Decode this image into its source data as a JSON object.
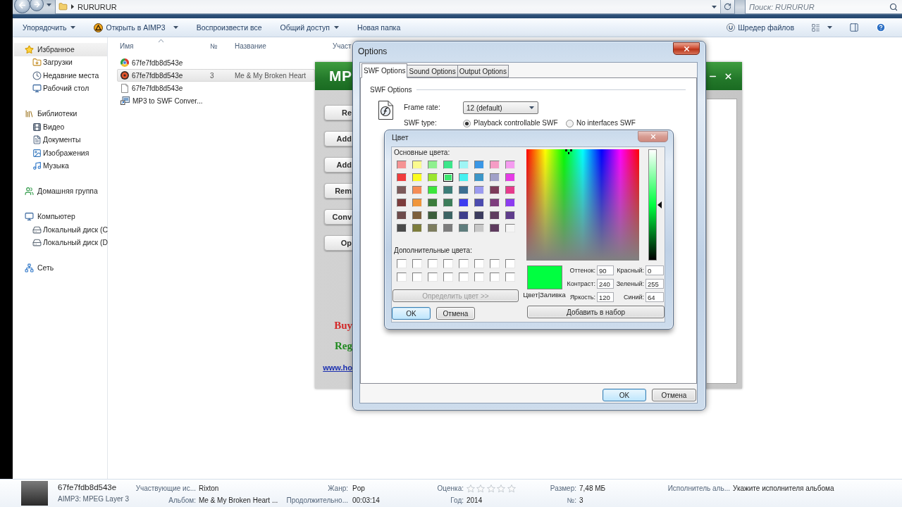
{
  "explorer": {
    "address_bar": {
      "path": "RURURUR"
    },
    "search": {
      "placeholder": "Поиск: RURURUR"
    },
    "toolbar": [
      {
        "label": "Упорядочить",
        "kind": "menu"
      },
      {
        "label": "Открыть в AIMP3",
        "kind": "app_menu"
      },
      {
        "label": "Воспроизвести все",
        "kind": "plain"
      },
      {
        "label": "Общий доступ",
        "kind": "menu"
      },
      {
        "label": "Новая папка",
        "kind": "plain"
      }
    ],
    "toolbar_right": [
      {
        "label": "Шредер файлов",
        "kind": "app"
      }
    ],
    "sidebar": [
      {
        "label": "Избранное",
        "selected": true,
        "children": [
          {
            "label": "Загрузки",
            "selected": false
          },
          {
            "label": "Недавние места",
            "selected": false
          },
          {
            "label": "Рабочий стол",
            "selected": false
          }
        ]
      },
      {
        "label": "Библиотеки",
        "selected": false,
        "children": [
          {
            "label": "Видео",
            "selected": false
          },
          {
            "label": "Документы",
            "selected": false
          },
          {
            "label": "Изображения",
            "selected": false
          },
          {
            "label": "Музыка",
            "selected": false
          }
        ]
      },
      {
        "label": "Домашняя группа",
        "selected": false
      },
      {
        "label": "Компьютер",
        "selected": false,
        "children": [
          {
            "label": "Локальный диск (C",
            "selected": false
          },
          {
            "label": "Локальный диск (D",
            "selected": false
          }
        ]
      },
      {
        "label": "Сеть",
        "selected": false
      }
    ],
    "columns": [
      "Имя",
      "№",
      "Название",
      "Участ"
    ],
    "files": [
      {
        "name": "67fe7fdb8d543e",
        "selected": false
      },
      {
        "name": "67fe7fdb8d543e",
        "number": "3",
        "title": "Me & My Broken Heart",
        "selected": true
      },
      {
        "name": "67fe7fdb8d543e",
        "selected": false
      },
      {
        "name": "MP3 to SWF Conver...",
        "selected": false
      }
    ]
  },
  "details": {
    "title": "67fe7fdb8d543e",
    "type": "AIMP3: MPEG Layer 3",
    "columns": [
      [
        {
          "label": "Участвующие ис...",
          "kind": "text",
          "value": "Rixton"
        },
        {
          "label": "Альбом:",
          "kind": "text",
          "value": "Me & My Broken Heart ..."
        }
      ],
      [
        {
          "label": "Жанр:",
          "kind": "text",
          "value": "Pop"
        },
        {
          "label": "Продолжительно...",
          "kind": "text",
          "value": "00:03:14"
        }
      ],
      [
        {
          "label": "Оценка:",
          "kind": "rating",
          "stars": 0
        },
        {
          "label": "Год:",
          "kind": "text",
          "value": "2014"
        }
      ],
      [
        {
          "label": "Размер:",
          "kind": "text",
          "value": "7,48 МБ"
        },
        {
          "label": "№:",
          "kind": "text",
          "value": "3"
        }
      ],
      [
        {
          "label": "Исполнитель аль...",
          "kind": "text",
          "value": "Укажите исполнителя альбома"
        }
      ]
    ]
  },
  "converter": {
    "title": "MP",
    "buttons": [
      "Re",
      "Add",
      "Add",
      "Rem",
      "Conv",
      "Op"
    ],
    "promos": [
      {
        "text": "Buy",
        "color": "#d42a2a"
      },
      {
        "text": "Reg",
        "color": "#1f8a1f"
      }
    ],
    "link": "www.ho"
  },
  "options_dialog": {
    "title": "Options",
    "tabs": [
      {
        "label": "SWF Options",
        "selected": true
      },
      {
        "label": "Sound Options",
        "selected": false
      },
      {
        "label": "Output Options",
        "selected": false
      }
    ],
    "group_title": "SWF Options",
    "frame_rate": {
      "label": "Frame rate:",
      "value": "12 (default)"
    },
    "swf_type": {
      "label": "SWF type:",
      "options": [
        {
          "label": "Playback controllable SWF",
          "selected": true
        },
        {
          "label": "No interfaces SWF",
          "selected": false
        }
      ]
    },
    "buttons": [
      {
        "label": "OK",
        "default": true
      },
      {
        "label": "Отмена",
        "default": false
      }
    ]
  },
  "color_dialog": {
    "title": "Цвет",
    "basic_label": "Основные цвета:",
    "basic_colors": [
      {
        "color": "#f59393",
        "selected": false
      },
      {
        "color": "#fbfb8f",
        "selected": false
      },
      {
        "color": "#8ff08f",
        "selected": false
      },
      {
        "color": "#3ce68a",
        "selected": false
      },
      {
        "color": "#9ff5f5",
        "selected": false
      },
      {
        "color": "#3a97e6",
        "selected": false
      },
      {
        "color": "#f59cc5",
        "selected": false
      },
      {
        "color": "#f59cf0",
        "selected": false
      },
      {
        "color": "#f03c3c",
        "selected": false
      },
      {
        "color": "#fbfb1e",
        "selected": false
      },
      {
        "color": "#9be62e",
        "selected": false
      },
      {
        "color": "#3ce66e",
        "selected": true
      },
      {
        "color": "#46f0f0",
        "selected": false
      },
      {
        "color": "#3c96c8",
        "selected": false
      },
      {
        "color": "#a0a0c8",
        "selected": false
      },
      {
        "color": "#e63ce6",
        "selected": false
      },
      {
        "color": "#7d5a5a",
        "selected": false
      },
      {
        "color": "#f58c55",
        "selected": false
      },
      {
        "color": "#3ce63c",
        "selected": false
      },
      {
        "color": "#3c7d78",
        "selected": false
      },
      {
        "color": "#3c6e91",
        "selected": false
      },
      {
        "color": "#9b9bf0",
        "selected": false
      },
      {
        "color": "#7d3c5a",
        "selected": false
      },
      {
        "color": "#e63c8c",
        "selected": false
      },
      {
        "color": "#7d3c3c",
        "selected": false
      },
      {
        "color": "#f0963c",
        "selected": false
      },
      {
        "color": "#3c7d3c",
        "selected": false
      },
      {
        "color": "#3c7d5a",
        "selected": false
      },
      {
        "color": "#3c3cf0",
        "selected": false
      },
      {
        "color": "#4b4baf",
        "selected": false
      },
      {
        "color": "#7d3c7d",
        "selected": false
      },
      {
        "color": "#8c3cf0",
        "selected": false
      },
      {
        "color": "#6e4b4b",
        "selected": false
      },
      {
        "color": "#7d5f3c",
        "selected": false
      },
      {
        "color": "#3c5f3c",
        "selected": false
      },
      {
        "color": "#3c6464",
        "selected": false
      },
      {
        "color": "#3c3c8c",
        "selected": false
      },
      {
        "color": "#3c3c5f",
        "selected": false
      },
      {
        "color": "#5f3c5f",
        "selected": false
      },
      {
        "color": "#5f3c8c",
        "selected": false
      },
      {
        "color": "#4b4b4b",
        "selected": false
      },
      {
        "color": "#7d7d3c",
        "selected": false
      },
      {
        "color": "#7d7d5f",
        "selected": false
      },
      {
        "color": "#7d7d7d",
        "selected": false
      },
      {
        "color": "#5f7d7d",
        "selected": false
      },
      {
        "color": "#c8c8c8",
        "selected": false
      },
      {
        "color": "#5f3c5f",
        "selected": false
      },
      {
        "color": "#f5f5f5",
        "selected": false
      }
    ],
    "custom_label": "Дополнительные цвета:",
    "custom_colors": [
      {
        "color": "#ffffff"
      },
      {
        "color": "#ffffff"
      },
      {
        "color": "#ffffff"
      },
      {
        "color": "#ffffff"
      },
      {
        "color": "#ffffff"
      },
      {
        "color": "#ffffff"
      },
      {
        "color": "#ffffff"
      },
      {
        "color": "#ffffff"
      },
      {
        "color": "#ffffff"
      },
      {
        "color": "#ffffff"
      },
      {
        "color": "#ffffff"
      },
      {
        "color": "#ffffff"
      },
      {
        "color": "#ffffff"
      },
      {
        "color": "#ffffff"
      },
      {
        "color": "#ffffff"
      },
      {
        "color": "#ffffff"
      }
    ],
    "define_button": {
      "label": "Определить цвет >>",
      "disabled": true
    },
    "buttons": [
      {
        "label": "OK",
        "default": true
      },
      {
        "label": "Отмена",
        "default": false
      }
    ],
    "luminance": {
      "level": 0.5
    },
    "preview": {
      "label": "Цвет|Заливка",
      "color": "#00ff40"
    },
    "fields": [
      {
        "label": "Оттенок:",
        "value": "90"
      },
      {
        "label": "Красный:",
        "value": "0"
      },
      {
        "label": "Контраст:",
        "value": "240"
      },
      {
        "label": "Зеленый:",
        "value": "255"
      },
      {
        "label": "Яркость:",
        "value": "120"
      },
      {
        "label": "Синий:",
        "value": "64"
      }
    ],
    "add_button": "Добавить в набор"
  }
}
